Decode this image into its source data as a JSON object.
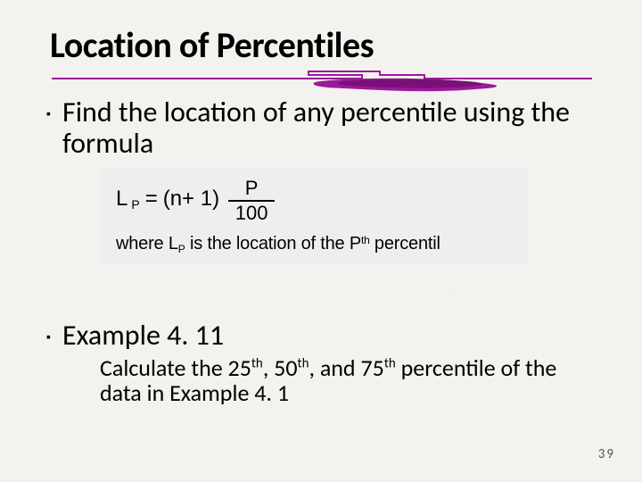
{
  "title": "Location of Percentiles",
  "accent_color": "#9a1a9a",
  "bullets": {
    "intro": "Find the location of any percentile using the formula",
    "formula": {
      "lhs_sym": "L",
      "lhs_sub": "P",
      "equals": "=",
      "n_expr": "(n+ 1)",
      "frac_num": "P",
      "frac_den": "100"
    },
    "formula_desc": {
      "where": "where",
      "lp_sym": "L",
      "lp_sub": "P",
      "mid": " is the location of the ",
      "p_sym": "P",
      "p_sup": "th",
      "tail": " percentil"
    },
    "example_heading": "Example 4. 11",
    "example_body_a": "Calculate the 25",
    "example_body_b": ", 50",
    "example_body_c": ", and 75",
    "example_body_d": " percentile of the data in Example 4. 1",
    "sup_th": "th"
  },
  "page_number": "39"
}
